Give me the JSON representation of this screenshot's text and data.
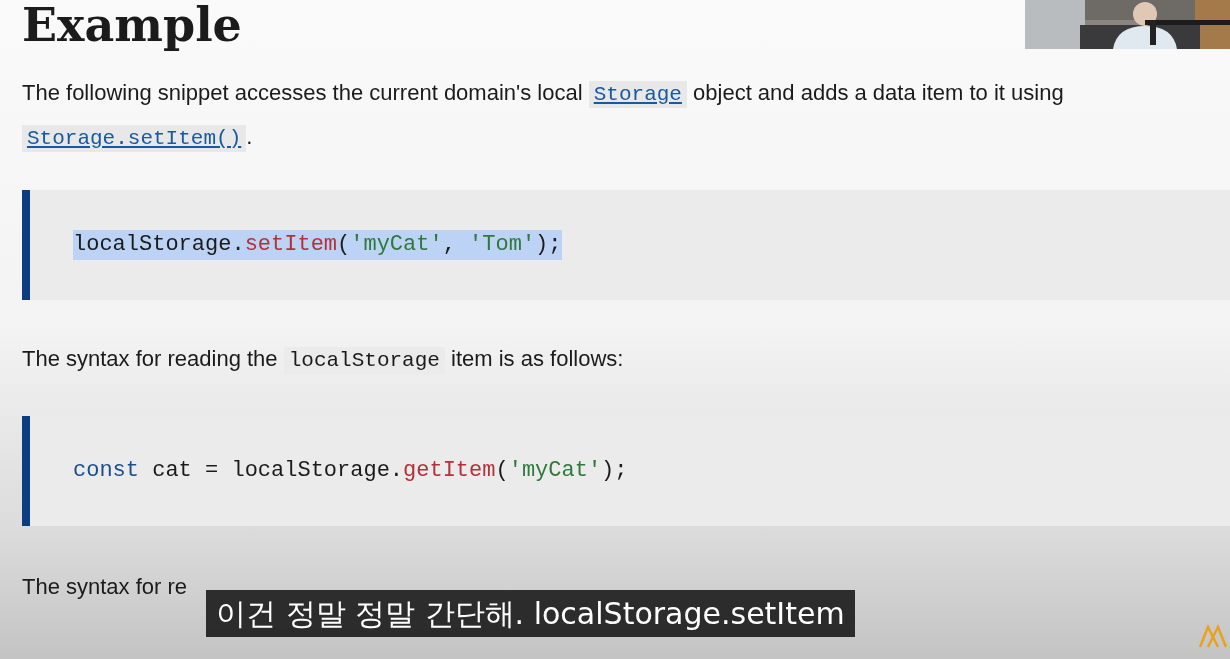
{
  "heading": "Example",
  "intro": [
    {
      "kind": "text",
      "text": "The following snippet accesses the current domain's local "
    },
    {
      "kind": "link",
      "text": "Storage"
    },
    {
      "kind": "text",
      "text": " object and adds a data item to it using "
    },
    {
      "kind": "link",
      "text": "Storage.setItem()"
    },
    {
      "kind": "text",
      "text": "."
    }
  ],
  "code_1": {
    "selected": true,
    "tokens": [
      {
        "kind": "plain",
        "text": "localStorage."
      },
      {
        "kind": "func",
        "text": "setItem"
      },
      {
        "kind": "plain",
        "text": "("
      },
      {
        "kind": "string",
        "text": "'myCat'"
      },
      {
        "kind": "plain",
        "text": ", "
      },
      {
        "kind": "string",
        "text": "'Tom'"
      },
      {
        "kind": "plain",
        "text": ");"
      }
    ]
  },
  "reading": [
    {
      "kind": "text",
      "text": "The syntax for reading the "
    },
    {
      "kind": "code",
      "text": "localStorage"
    },
    {
      "kind": "text",
      "text": " item is as follows:"
    }
  ],
  "code_2": {
    "selected": false,
    "tokens": [
      {
        "kind": "keyword",
        "text": "const"
      },
      {
        "kind": "plain",
        "text": " cat = localStorage."
      },
      {
        "kind": "func",
        "text": "getItem"
      },
      {
        "kind": "plain",
        "text": "("
      },
      {
        "kind": "string",
        "text": "'myCat'"
      },
      {
        "kind": "plain",
        "text": ");"
      }
    ]
  },
  "removing": "The syntax for re",
  "subtitle": "이건 정말 정말 간단해. localStorage.setItem"
}
